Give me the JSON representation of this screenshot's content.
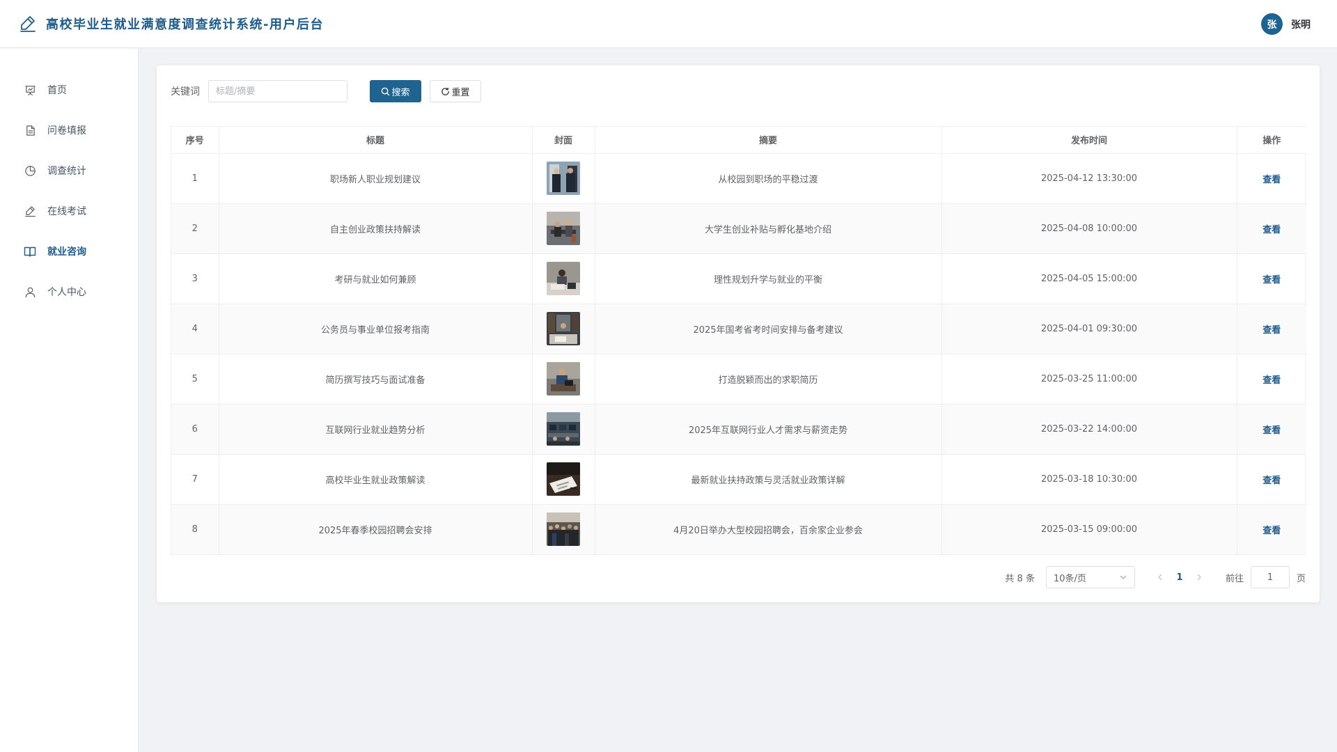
{
  "header": {
    "title": "高校毕业生就业满意度调查统计系统-用户后台",
    "user_initial": "张",
    "user_name": "张明"
  },
  "sidebar": {
    "items": [
      {
        "label": "首页",
        "icon": "presentation-icon"
      },
      {
        "label": "问卷填报",
        "icon": "document-icon"
      },
      {
        "label": "调查统计",
        "icon": "pie-chart-icon"
      },
      {
        "label": "在线考试",
        "icon": "pen-icon"
      },
      {
        "label": "就业咨询",
        "icon": "book-icon",
        "active": true
      },
      {
        "label": "个人中心",
        "icon": "user-icon"
      }
    ]
  },
  "search": {
    "keyword_label": "关键词",
    "placeholder": "标题/摘要",
    "search_button": "搜索",
    "reset_button": "重置"
  },
  "table": {
    "columns": [
      "序号",
      "标题",
      "封面",
      "摘要",
      "发布时间",
      "操作"
    ],
    "rows": [
      {
        "index": "1",
        "title": "职场新人职业规划建议",
        "summary": "从校园到职场的平稳过渡",
        "time": "2025-04-12 13:30:00",
        "action": "查看"
      },
      {
        "index": "2",
        "title": "自主创业政策扶持解读",
        "summary": "大学生创业补贴与孵化基地介绍",
        "time": "2025-04-08 10:00:00",
        "action": "查看"
      },
      {
        "index": "3",
        "title": "考研与就业如何兼顾",
        "summary": "理性规划升学与就业的平衡",
        "time": "2025-04-05 15:00:00",
        "action": "查看"
      },
      {
        "index": "4",
        "title": "公务员与事业单位报考指南",
        "summary": "2025年国考省考时间安排与备考建议",
        "time": "2025-04-01 09:30:00",
        "action": "查看"
      },
      {
        "index": "5",
        "title": "简历撰写技巧与面试准备",
        "summary": "打造脱颖而出的求职简历",
        "time": "2025-03-25 11:00:00",
        "action": "查看"
      },
      {
        "index": "6",
        "title": "互联网行业就业趋势分析",
        "summary": "2025年互联网行业人才需求与薪资走势",
        "time": "2025-03-22 14:00:00",
        "action": "查看"
      },
      {
        "index": "7",
        "title": "高校毕业生就业政策解读",
        "summary": "最新就业扶持政策与灵活就业政策详解",
        "time": "2025-03-18 10:30:00",
        "action": "查看"
      },
      {
        "index": "8",
        "title": "2025年春季校园招聘会安排",
        "summary": "4月20日举办大型校园招聘会，百余家企业参会",
        "time": "2025-03-15 09:00:00",
        "action": "查看"
      }
    ]
  },
  "pagination": {
    "total": "共 8 条",
    "page_size": "10条/页",
    "current_page": "1",
    "goto_label": "前往",
    "goto_value": "1",
    "page_suffix": "页"
  },
  "colors": {
    "primary": "#1f6391",
    "title": "#1f5c8c"
  }
}
